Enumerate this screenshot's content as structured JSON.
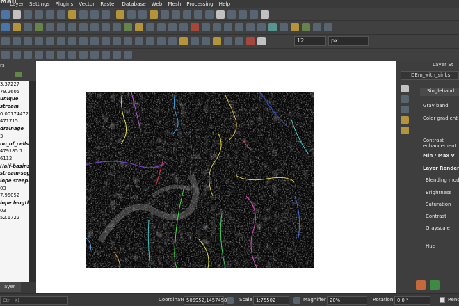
{
  "app": {
    "title": "Mail"
  },
  "menu": [
    "Layer",
    "Settings",
    "Plugins",
    "Vector",
    "Raster",
    "Database",
    "Web",
    "Mesh",
    "Processing",
    "Help"
  ],
  "toolbar": {
    "font_size": "12",
    "unit": "px"
  },
  "left_panel": {
    "title": "rs",
    "rows": [
      "3.37227",
      "79.2605",
      "unique",
      "stream",
      "0.00174472",
      "471715",
      "drainage",
      "3",
      "no_of_cells",
      "479185.7",
      "6112",
      "Half-basins",
      "stream-segm",
      "lope steepne",
      "03",
      "7.95052",
      "lope length",
      "03",
      "52.1722"
    ],
    "tab": "ayer"
  },
  "right_panel": {
    "title": "Layer St",
    "layer": "DEm_with_sinks",
    "render_type": "Singleband",
    "gray_band": "Gray band",
    "color_gradient": "Color gradient",
    "contrast": "Contrast",
    "enhancement": "enhancement",
    "minmax": "Min / Max V",
    "rendering": "Layer Rendering",
    "blending": "Blending mode",
    "brightness": "Brightness",
    "saturation": "Saturation",
    "contrast2": "Contrast",
    "grayscale": "Grayscale",
    "hue": "Hue"
  },
  "status": {
    "search_hint": "Ctrl+K)",
    "coordinate_label": "Coordinate",
    "coordinate": "505952,1457458",
    "scale_label": "Scale",
    "scale": "1:75502",
    "magnifier_label": "Magnifier",
    "magnifier": "20%",
    "rotation_label": "Rotation",
    "rotation": "0.0 °",
    "render_label": "Rend"
  }
}
